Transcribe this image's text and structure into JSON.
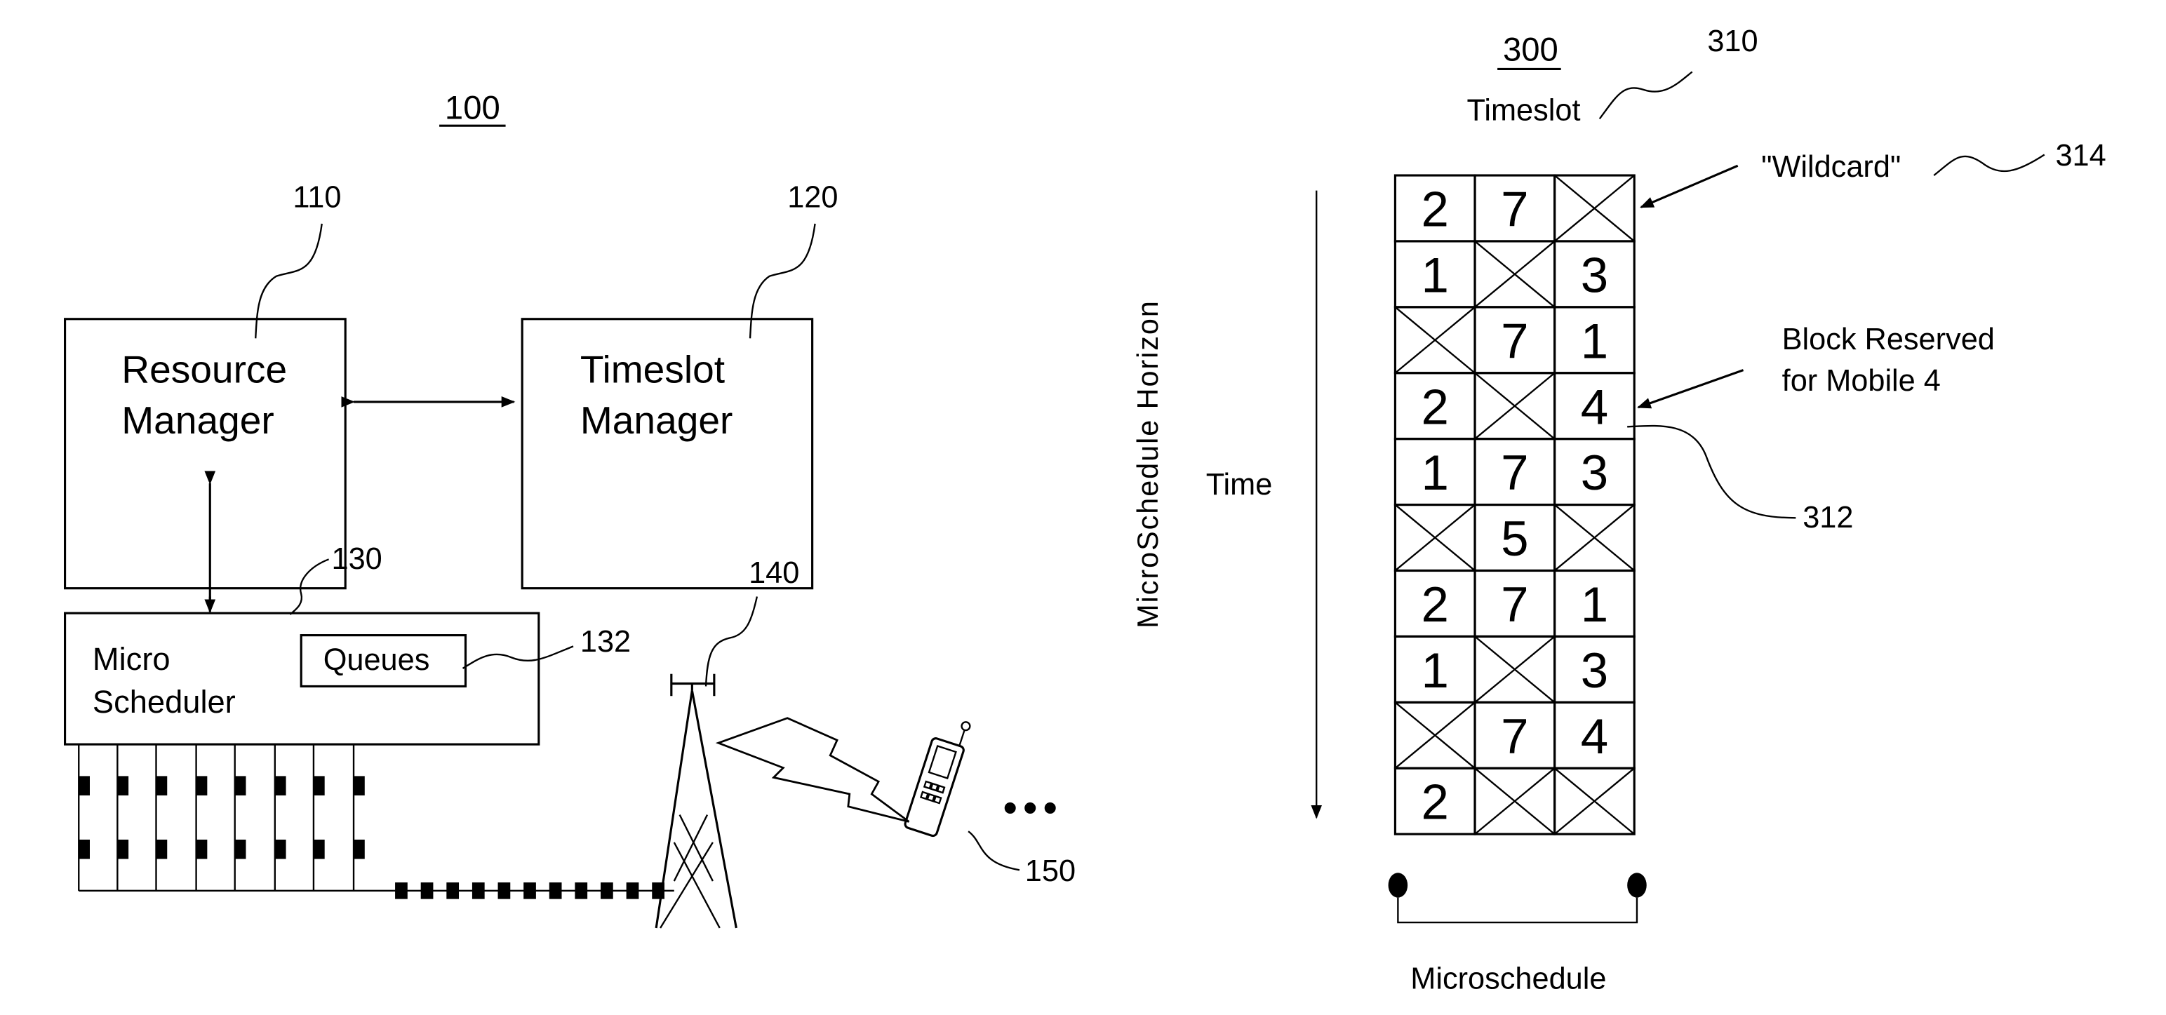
{
  "figure_left": {
    "figure_number": "100",
    "resource_manager": {
      "ref": "110",
      "line1": "Resource",
      "line2": "Manager"
    },
    "timeslot_manager": {
      "ref": "120",
      "line1": "Timeslot",
      "line2": "Manager"
    },
    "micro_scheduler": {
      "ref": "130",
      "line1": "Micro",
      "line2": "Scheduler"
    },
    "queues": {
      "ref": "132",
      "label": "Queues"
    },
    "base_station": {
      "ref": "140"
    },
    "mobile": {
      "ref": "150"
    },
    "continuation": "•••"
  },
  "figure_right": {
    "figure_number": "300",
    "timeslot_label": "Timeslot",
    "timeslot_ref": "310",
    "wildcard_label": "\"Wildcard\"",
    "wildcard_ref": "314",
    "reserved_label_line1": "Block Reserved",
    "reserved_label_line2": "for Mobile 4",
    "reserved_ref": "312",
    "horizon_label": "MicroSchedule Horizon",
    "time_label": "Time",
    "microschedule_label": "Microschedule",
    "grid": [
      [
        "2",
        "7",
        "X"
      ],
      [
        "1",
        "X",
        "3"
      ],
      [
        "X",
        "7",
        "1"
      ],
      [
        "2",
        "X",
        "4"
      ],
      [
        "1",
        "7",
        "3"
      ],
      [
        "X",
        "5",
        "X"
      ],
      [
        "2",
        "7",
        "1"
      ],
      [
        "1",
        "X",
        "3"
      ],
      [
        "X",
        "7",
        "4"
      ],
      [
        "2",
        "X",
        "X"
      ]
    ]
  }
}
